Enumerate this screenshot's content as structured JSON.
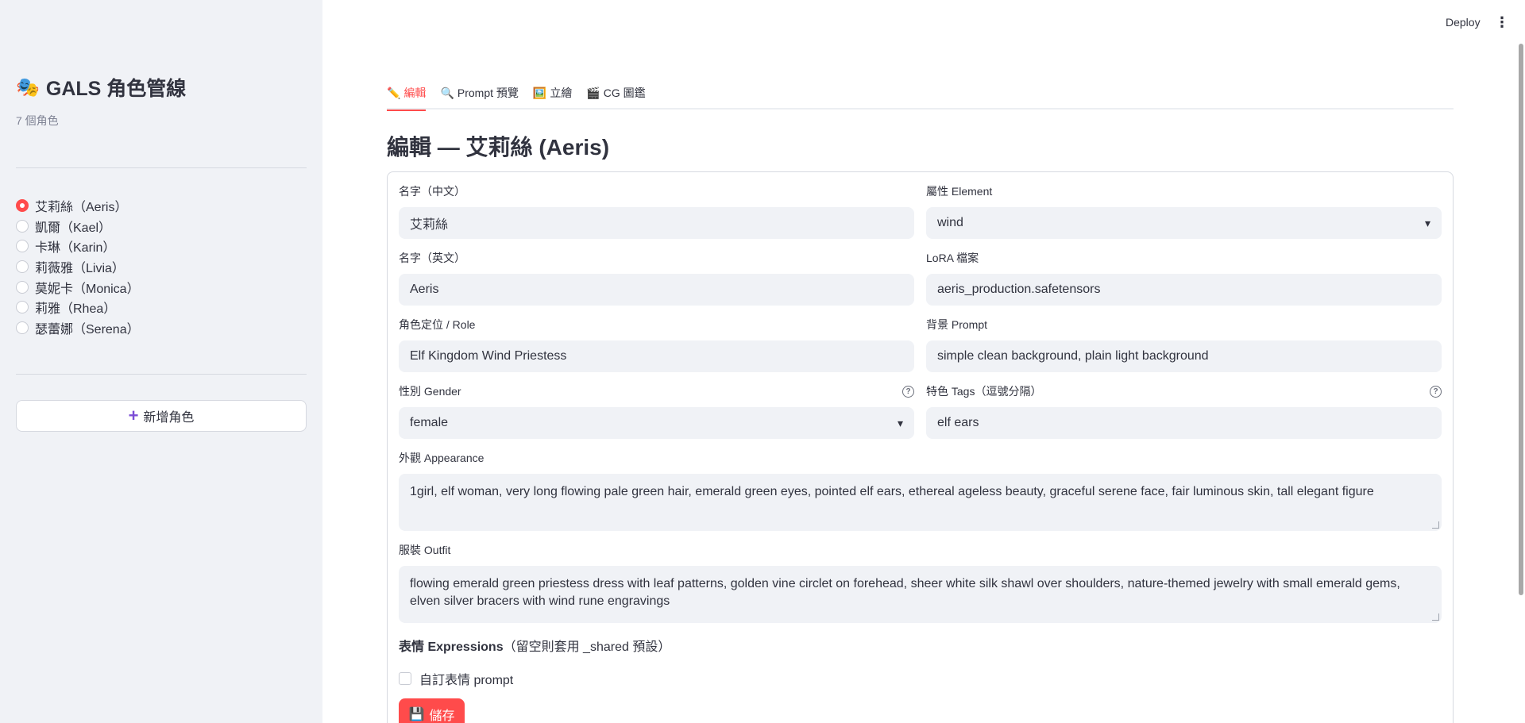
{
  "app": {
    "title": "GALS 角色管線",
    "logo_icon": "performing-arts-icon",
    "count": "7 個角色"
  },
  "header": {
    "deploy_label": "Deploy"
  },
  "sidebar": {
    "characters": [
      {
        "label": "艾莉絲（Aeris）",
        "selected": true
      },
      {
        "label": "凱爾（Kael）",
        "selected": false
      },
      {
        "label": "卡琳（Karin）",
        "selected": false
      },
      {
        "label": "莉薇雅（Livia）",
        "selected": false
      },
      {
        "label": "莫妮卡（Monica）",
        "selected": false
      },
      {
        "label": "莉雅（Rhea）",
        "selected": false
      },
      {
        "label": "瑟蕾娜（Serena）",
        "selected": false
      }
    ],
    "add_button": "新增角色"
  },
  "tabs": [
    {
      "label": "編輯",
      "icon": "pencil-icon",
      "active": true
    },
    {
      "label": "Prompt 預覽",
      "icon": "magnifier-icon",
      "active": false
    },
    {
      "label": "立繪",
      "icon": "picture-icon",
      "active": false
    },
    {
      "label": "CG 圖鑑",
      "icon": "clapper-icon",
      "active": false
    }
  ],
  "page_title": "編輯 — 艾莉絲 (Aeris)",
  "form": {
    "name_zh": {
      "label": "名字（中文）",
      "value": "艾莉絲"
    },
    "element": {
      "label": "屬性 Element",
      "value": "wind"
    },
    "name_en": {
      "label": "名字（英文）",
      "value": "Aeris"
    },
    "lora": {
      "label": "LoRA 檔案",
      "value": "aeris_production.safetensors"
    },
    "role": {
      "label": "角色定位 / Role",
      "value": "Elf Kingdom Wind Priestess"
    },
    "bg_prompt": {
      "label": "背景 Prompt",
      "value": "simple clean background, plain light background"
    },
    "gender": {
      "label": "性別 Gender",
      "value": "female"
    },
    "tags": {
      "label": "特色 Tags（逗號分隔）",
      "value": "elf ears"
    },
    "appearance": {
      "label": "外觀 Appearance",
      "value": "1girl, elf woman, very long flowing pale green hair, emerald green eyes, pointed elf ears, ethereal ageless beauty, graceful serene face, fair luminous skin, tall elegant figure"
    },
    "outfit": {
      "label": "服裝 Outfit",
      "value": "flowing emerald green priestess dress with leaf patterns, golden vine circlet on forehead, sheer white silk shawl over shoulders, nature-themed jewelry with small emerald gems, elven silver bracers with wind rune engravings"
    },
    "expressions_heading_bold": "表情 Expressions",
    "expressions_heading_rest": "（留空則套用 _shared 預設）",
    "custom_expression_label": "自訂表情 prompt",
    "save_button": "儲存"
  },
  "colors": {
    "accent": "#ff4b4b",
    "sidebar_bg": "#f0f2f6",
    "input_bg": "#f0f2f6"
  }
}
